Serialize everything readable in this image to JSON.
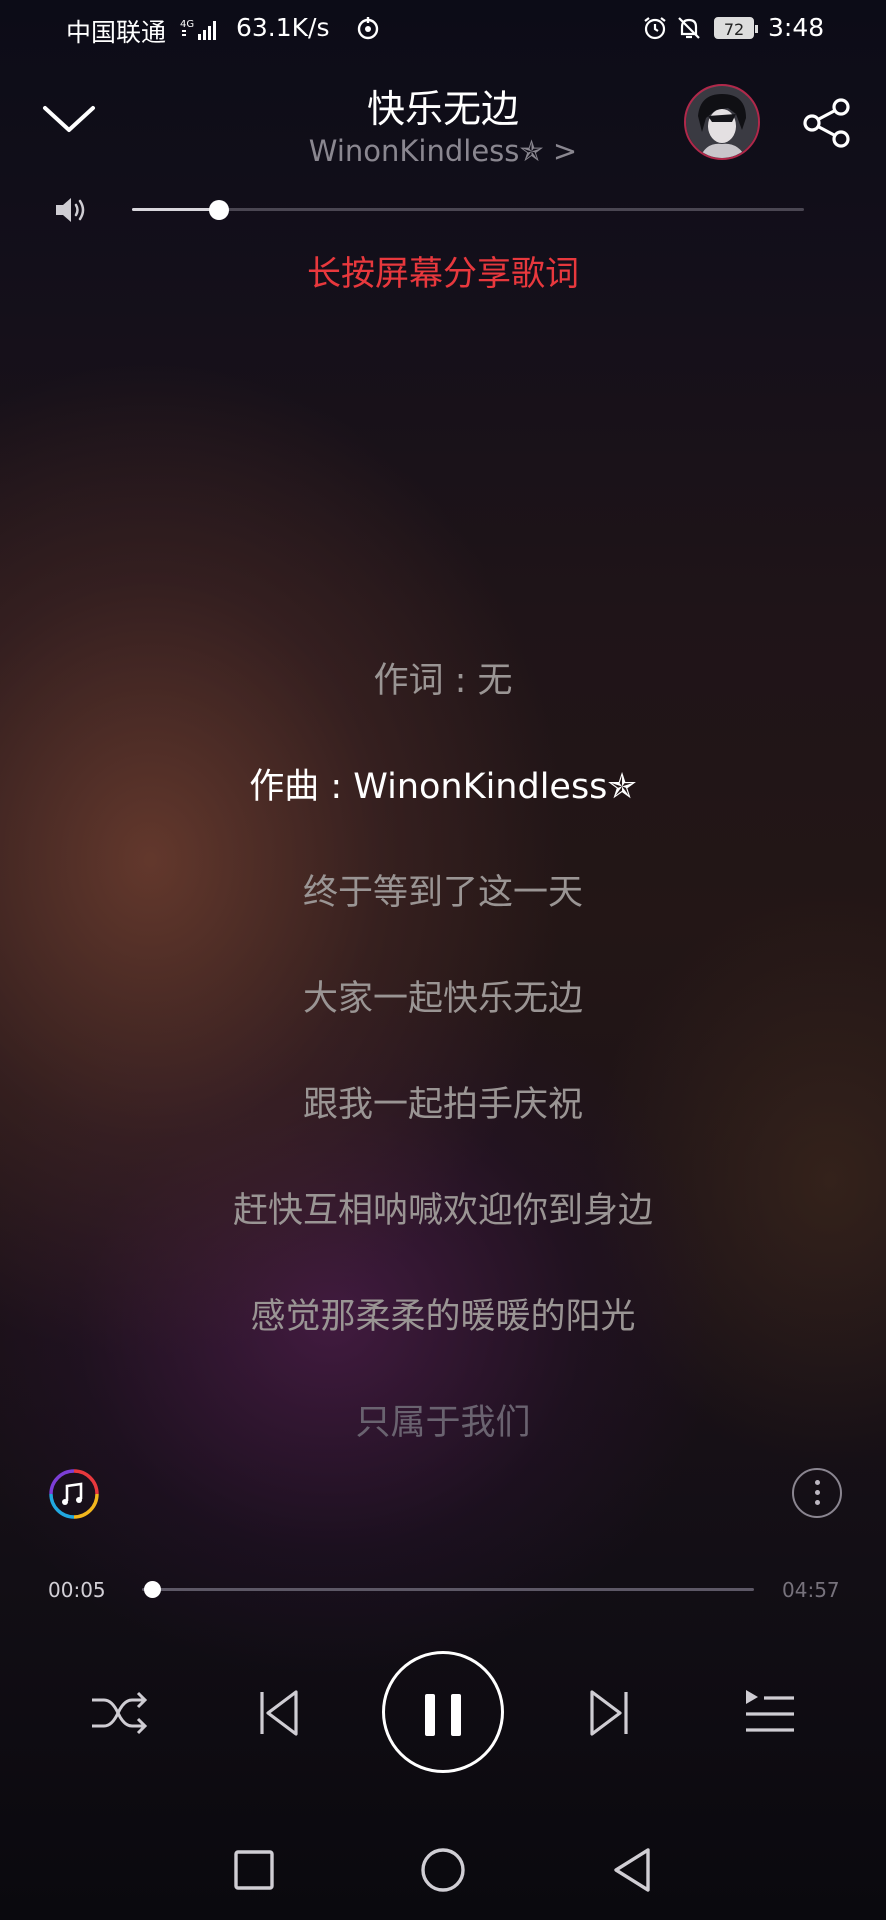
{
  "status_bar": {
    "carrier": "中国联通",
    "network": "4G",
    "speed": "63.1K/s",
    "battery": "72",
    "time": "3:48"
  },
  "header": {
    "song_title": "快乐无边",
    "artist": "WinonKindless✯ >"
  },
  "volume": {
    "level": 0.13
  },
  "share_hint": "长按屏幕分享歌词",
  "lyrics": [
    {
      "text": "作词 : 无",
      "state": "normal"
    },
    {
      "text": "作曲 : WinonKindless✯",
      "state": "current"
    },
    {
      "text": "终于等到了这一天",
      "state": "normal"
    },
    {
      "text": "大家一起快乐无边",
      "state": "normal"
    },
    {
      "text": "跟我一起拍手庆祝",
      "state": "normal"
    },
    {
      "text": "赶快互相呐喊欢迎你到身边",
      "state": "normal"
    },
    {
      "text": "感觉那柔柔的暖暖的阳光",
      "state": "normal"
    },
    {
      "text": "只属于我们",
      "state": "faded"
    }
  ],
  "playback": {
    "current_time": "00:05",
    "total_time": "04:57",
    "progress": 0.017,
    "state": "playing"
  },
  "controls": [
    "shuffle-icon",
    "previous-icon",
    "pause-icon",
    "next-icon",
    "playlist-icon"
  ],
  "nav_bar": [
    "recents-icon",
    "home-icon",
    "back-icon"
  ],
  "colors": {
    "accent_red": "#e8383d",
    "avatar_ring": "#b0284a"
  }
}
